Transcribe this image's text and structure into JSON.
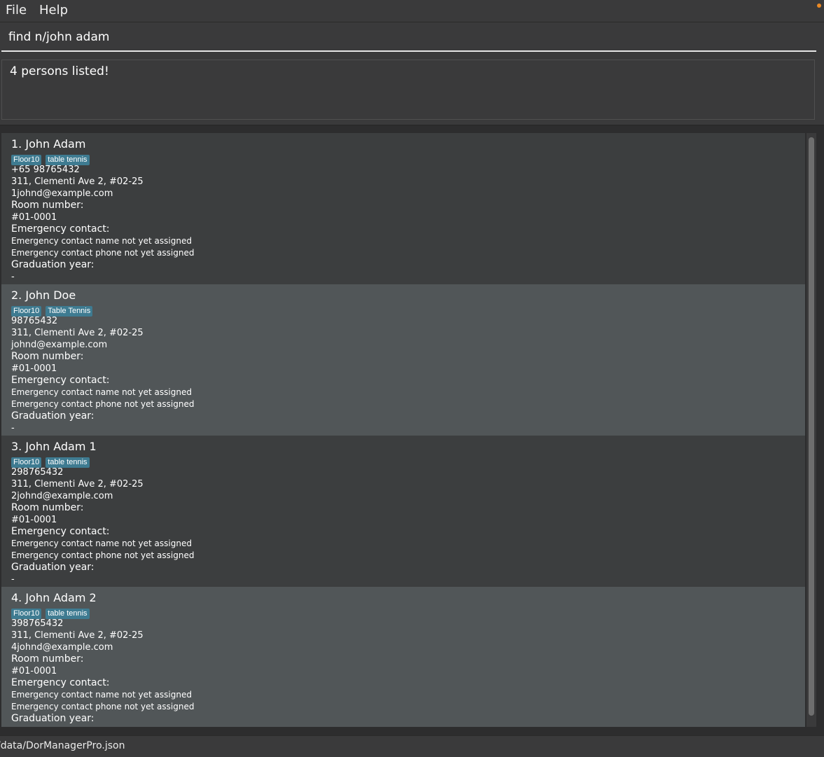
{
  "menu": {
    "file_label": "File",
    "help_label": "Help"
  },
  "command": {
    "value": "find n/john adam"
  },
  "result": {
    "text": "4 persons listed!"
  },
  "persons": [
    {
      "name": "1. John Adam",
      "tags": [
        "Floor10",
        "table tennis"
      ],
      "phone": "+65 98765432",
      "address": "311, Clementi Ave 2, #02-25",
      "email": "1johnd@example.com",
      "room_label": "Room number:",
      "room": "#01-0001",
      "emergency_label": "Emergency contact:",
      "emergency_name": "Emergency contact name not yet assigned",
      "emergency_phone": "Emergency contact phone not yet assigned",
      "grad_label": "Graduation year:",
      "grad": "-"
    },
    {
      "name": "2. John Doe",
      "tags": [
        "Floor10",
        "Table Tennis"
      ],
      "phone": "98765432",
      "address": "311, Clementi Ave 2, #02-25",
      "email": "johnd@example.com",
      "room_label": "Room number:",
      "room": "#01-0001",
      "emergency_label": "Emergency contact:",
      "emergency_name": "Emergency contact name not yet assigned",
      "emergency_phone": "Emergency contact phone not yet assigned",
      "grad_label": "Graduation year:",
      "grad": "-"
    },
    {
      "name": "3. John Adam 1",
      "tags": [
        "Floor10",
        "table tennis"
      ],
      "phone": "298765432",
      "address": "311, Clementi Ave 2, #02-25",
      "email": "2johnd@example.com",
      "room_label": "Room number:",
      "room": "#01-0001",
      "emergency_label": "Emergency contact:",
      "emergency_name": "Emergency contact name not yet assigned",
      "emergency_phone": "Emergency contact phone not yet assigned",
      "grad_label": "Graduation year:",
      "grad": "-"
    },
    {
      "name": "4. John Adam 2",
      "tags": [
        "Floor10",
        "table tennis"
      ],
      "phone": "398765432",
      "address": "311, Clementi Ave 2, #02-25",
      "email": "4johnd@example.com",
      "room_label": "Room number:",
      "room": "#01-0001",
      "emergency_label": "Emergency contact:",
      "emergency_name": "Emergency contact name not yet assigned",
      "emergency_phone": "Emergency contact phone not yet assigned",
      "grad_label": "Graduation year:"
    }
  ],
  "status_bar": {
    "save_path": "/data/DorManagerPro.json"
  },
  "colors": {
    "tag_bg": "#3e7b91",
    "accent_dot": "#ec8a24",
    "card_odd": "#3c3e3f",
    "card_even": "#515658"
  }
}
